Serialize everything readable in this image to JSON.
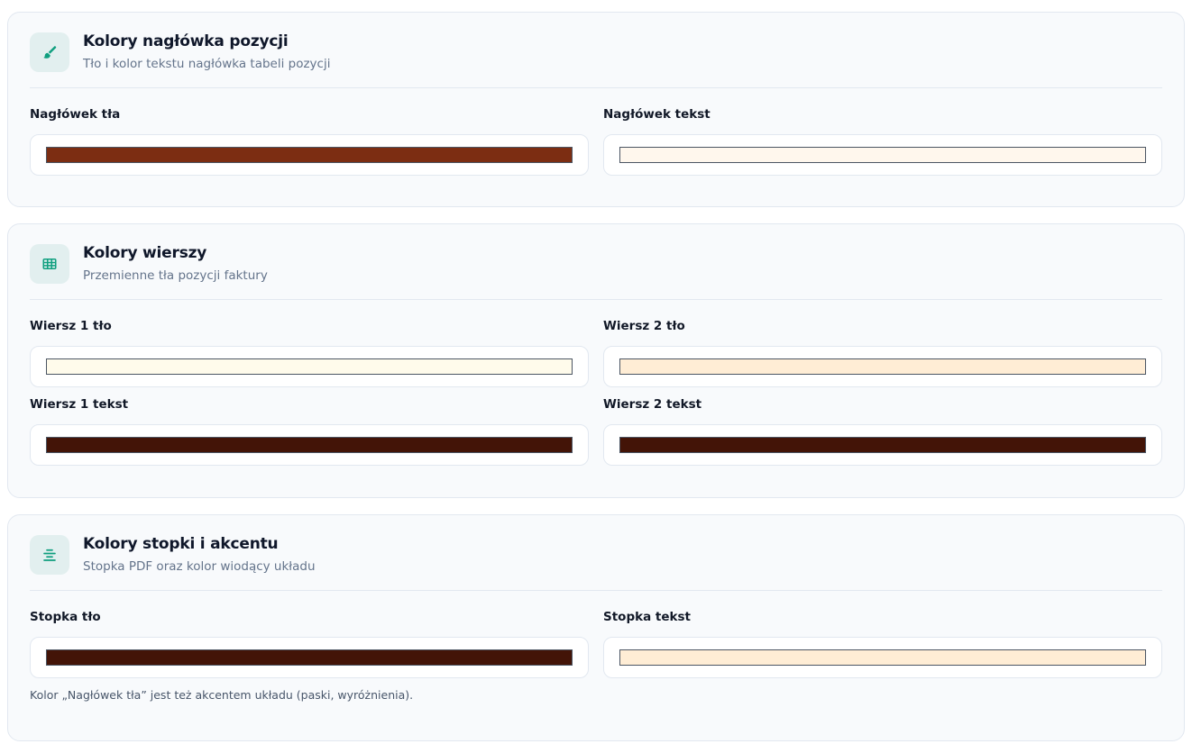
{
  "sections": [
    {
      "title": "Kolory nagłówka pozycji",
      "subtitle": "Tło i kolor tekstu nagłówka tabeli pozycji",
      "icon": "paintbrush-icon",
      "fields": [
        {
          "label": "Nagłówek tła",
          "color": "#7c2d12"
        },
        {
          "label": "Nagłówek tekst",
          "color": "#fff7ed"
        }
      ]
    },
    {
      "title": "Kolory wierszy",
      "subtitle": "Przemienne tła pozycji faktury",
      "icon": "table-icon",
      "fields": [
        {
          "label": "Wiersz 1 tło",
          "color": "#fffbeb"
        },
        {
          "label": "Wiersz 2 tło",
          "color": "#ffedd5"
        },
        {
          "label": "Wiersz 1 tekst",
          "color": "#431407"
        },
        {
          "label": "Wiersz 2 tekst",
          "color": "#431407"
        }
      ]
    },
    {
      "title": "Kolory stopki i akcentu",
      "subtitle": "Stopka PDF oraz kolor wiodący układu",
      "icon": "align-center-icon",
      "fields": [
        {
          "label": "Stopka tło",
          "color": "#431407"
        },
        {
          "label": "Stopka tekst",
          "color": "#ffedd5"
        }
      ],
      "note": "Kolor „Nagłówek tła” jest też akcentem układu (paski, wyróżnienia)."
    }
  ],
  "colors": {
    "accent": "#0f9f7f",
    "icon_bg": "#e2efef"
  }
}
